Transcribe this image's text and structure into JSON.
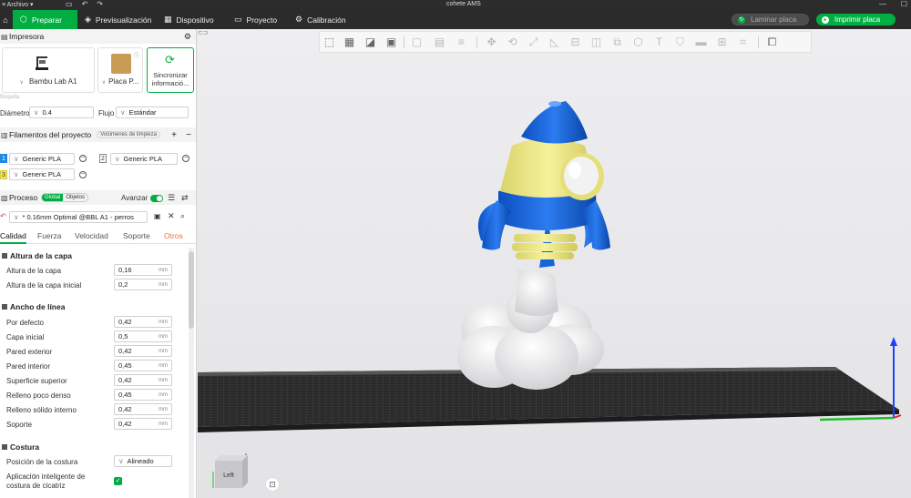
{
  "titlebar": {
    "menu_label": "Archivo",
    "document_title": "cohete AMS",
    "quick_actions": [
      "save-icon",
      "undo-icon",
      "redo-icon"
    ],
    "window_buttons": [
      "minimize-icon",
      "maximize-icon",
      "close-icon"
    ]
  },
  "nav": {
    "tabs": [
      {
        "label": "Preparar",
        "icon": "cube-icon",
        "active": true
      },
      {
        "label": "Previsualización",
        "icon": "layers-icon",
        "active": false
      },
      {
        "label": "Dispositivo",
        "icon": "device-icon",
        "active": false
      },
      {
        "label": "Proyecto",
        "icon": "project-icon",
        "active": false
      },
      {
        "label": "Calibración",
        "icon": "calibration-icon",
        "active": false
      }
    ],
    "slice_label": "Laminar placa",
    "print_label": "Imprimir placa"
  },
  "printer": {
    "section_title": "Impresora",
    "printer_name": "Bambu Lab A1",
    "plate_label": "Placa P...",
    "sync_label_line1": "Sincronizar",
    "sync_label_line2": "informació...",
    "nozzle_group_label": "Boquilla",
    "diameter_label": "Diámetro",
    "diameter_value": "0.4",
    "flow_label": "Flujo",
    "flow_value": "Estándar"
  },
  "filaments": {
    "section_title": "Filamentos del proyecto",
    "purge_chip": "Volúmenes de limpieza",
    "items": [
      {
        "num": "1",
        "name": "Generic PLA",
        "color": "#1e88e5"
      },
      {
        "num": "2",
        "name": "Generic PLA",
        "color": "#ffffff"
      },
      {
        "num": "3",
        "name": "Generic PLA",
        "color": "#f5e663"
      }
    ]
  },
  "process": {
    "section_title": "Proceso",
    "seg_global": "Global",
    "seg_objects": "Objetos",
    "advanced_label": "Avanzar",
    "preset_value": "* 0.16mm Optimal @BBL A1 - perros",
    "tabs": [
      "Calidad",
      "Fuerza",
      "Velocidad",
      "Soporte",
      "Otros"
    ],
    "groups": {
      "layer_height": {
        "title": "Altura de la capa",
        "params": [
          {
            "label": "Altura de la capa",
            "value": "0,16",
            "unit": "mm"
          },
          {
            "label": "Altura de la capa inicial",
            "value": "0,2",
            "unit": "mm"
          }
        ]
      },
      "line_width": {
        "title": "Ancho de línea",
        "params": [
          {
            "label": "Por defecto",
            "value": "0,42",
            "unit": "mm"
          },
          {
            "label": "Capa inicial",
            "value": "0,5",
            "unit": "mm"
          },
          {
            "label": "Pared exterior",
            "value": "0,42",
            "unit": "mm"
          },
          {
            "label": "Pared interior",
            "value": "0,45",
            "unit": "mm"
          },
          {
            "label": "Superficie superior",
            "value": "0,42",
            "unit": "mm"
          },
          {
            "label": "Relleno poco denso",
            "value": "0,45",
            "unit": "mm"
          },
          {
            "label": "Relleno sólido interno",
            "value": "0,42",
            "unit": "mm"
          },
          {
            "label": "Soporte",
            "value": "0,42",
            "unit": "mm"
          }
        ]
      },
      "seam": {
        "title": "Costura",
        "position_label": "Posición de la costura",
        "position_value": "Alineado",
        "smart_label_line1": "Aplicación inteligente de",
        "smart_label_line2": "costura de cicatriz"
      }
    }
  },
  "viewport": {
    "viewcube_label": "Left",
    "colors": {
      "rocket_blue": "#1565d8",
      "rocket_yellow": "#efe98a",
      "cloud": "#f4f4f4",
      "bed": "#2a2a2a",
      "accent": "#00ae42"
    }
  }
}
